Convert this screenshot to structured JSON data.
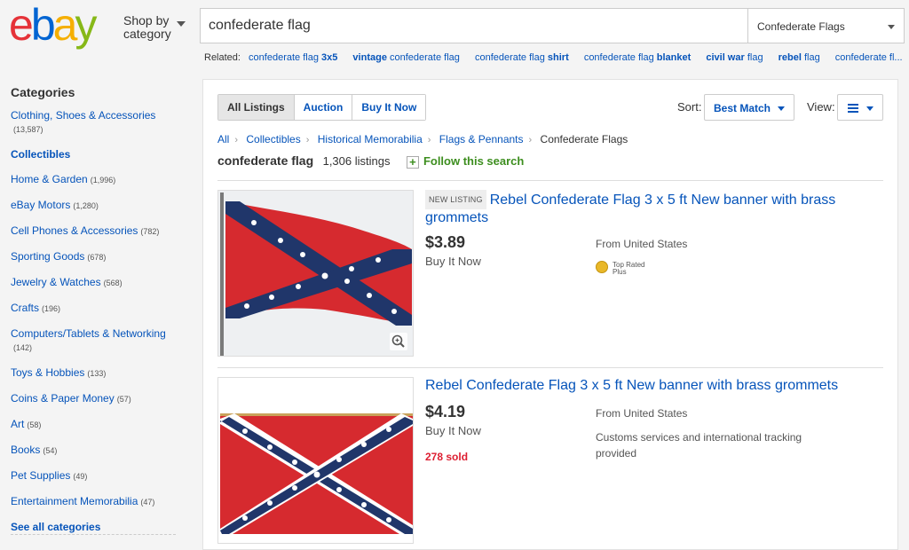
{
  "header": {
    "logo_letters": [
      "e",
      "b",
      "a",
      "y"
    ],
    "logo_colors": [
      "#e53238",
      "#0064d2",
      "#f5af02",
      "#86b817"
    ],
    "shop_by": "Shop by",
    "shop_by_category": "category",
    "search_value": "confederate flag",
    "category_select": "Confederate Flags",
    "related_label": "Related:",
    "related": [
      {
        "base": "confederate flag ",
        "bold": "3x5",
        "pre": ""
      },
      {
        "base": " confederate flag",
        "bold": "vintage",
        "pre": "",
        "bold_first": true
      },
      {
        "base": "confederate flag ",
        "bold": "shirt",
        "pre": ""
      },
      {
        "base": "confederate flag ",
        "bold": "blanket",
        "pre": ""
      },
      {
        "base": " flag",
        "bold": "civil war",
        "pre": "",
        "bold_first": true
      },
      {
        "base": " flag",
        "bold": "rebel",
        "pre": "",
        "bold_first": true
      },
      {
        "base": "confederate fl...",
        "bold": "",
        "pre": ""
      }
    ]
  },
  "sidebar": {
    "title": "Categories",
    "items": [
      {
        "label": "Clothing, Shoes & Accessories",
        "count": "(13,587)",
        "wrap": true
      },
      {
        "label": "Collectibles",
        "count": "",
        "bold": true
      },
      {
        "label": "Home & Garden",
        "count": "(1,996)"
      },
      {
        "label": "eBay Motors",
        "count": "(1,280)"
      },
      {
        "label": "Cell Phones & Accessories",
        "count": "(782)"
      },
      {
        "label": "Sporting Goods",
        "count": "(678)"
      },
      {
        "label": "Jewelry & Watches",
        "count": "(568)"
      },
      {
        "label": "Crafts",
        "count": "(196)"
      },
      {
        "label": "Computers/Tablets & Networking",
        "count": "(142)",
        "wrap": true
      },
      {
        "label": "Toys & Hobbies",
        "count": "(133)"
      },
      {
        "label": "Coins & Paper Money",
        "count": "(57)"
      },
      {
        "label": "Art",
        "count": "(58)"
      },
      {
        "label": "Books",
        "count": "(54)"
      },
      {
        "label": "Pet Supplies",
        "count": "(49)"
      },
      {
        "label": "Entertainment Memorabilia",
        "count": "(47)"
      },
      {
        "label": "See all categories",
        "count": "",
        "bold": true
      }
    ]
  },
  "toolbar": {
    "tabs": [
      "All Listings",
      "Auction",
      "Buy It Now"
    ],
    "sort_label": "Sort:",
    "sort_value": "Best Match",
    "view_label": "View:"
  },
  "breadcrumb": [
    "All",
    "Collectibles",
    "Historical Memorabilia",
    "Flags & Pennants",
    "Confederate Flags"
  ],
  "results": {
    "query": "confederate flag",
    "count": "1,306 listings",
    "follow": "Follow this search"
  },
  "listings": [
    {
      "badge": "NEW LISTING",
      "title": "Rebel Confederate Flag 3 x 5 ft New banner with brass grommets",
      "price": "$3.89",
      "format": "Buy It Now",
      "sold": "",
      "from": "From United States",
      "extra": "",
      "top_rated": [
        "Top Rated",
        "Plus"
      ]
    },
    {
      "badge": "",
      "title": "Rebel Confederate Flag 3 x 5 ft New banner with brass grommets",
      "price": "$4.19",
      "format": "Buy It Now",
      "sold": "278 sold",
      "from": "From United States",
      "extra": "Customs services and international tracking provided",
      "top_rated": []
    }
  ],
  "colors": {
    "link": "#0654ba",
    "flag_red": "#d62a2f",
    "flag_blue": "#20366a",
    "sold_red": "#dd1e31",
    "follow_green": "#3d8e1f"
  }
}
